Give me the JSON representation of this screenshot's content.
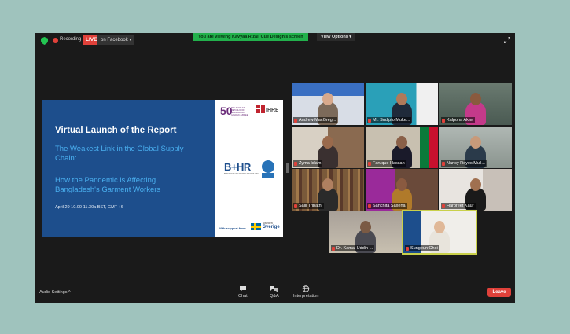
{
  "topbar": {
    "recording_label": "Recording",
    "live_badge": "LIVE",
    "live_destination": "on Facebook",
    "viewing_banner": "You are viewing Kavyaa Rizal, Cue Design's screen",
    "view_options": "View Options"
  },
  "slide": {
    "title": "Virtual Launch of the Report",
    "subtitle_1": "The Weakest Link in the Global Supply Chain:",
    "subtitle_2": "How the Pandemic is Affecting Bangladesh's Garment Workers",
    "date": "April 29 10.00-11.30a BST, GMT +6",
    "logo_50": "50",
    "logo_50_text": "THE PEOPLE'S REPUBLIC OF BANGLADESH GOLDEN JUBILEE",
    "logo_ihrb": "IHRB",
    "logo_bhr": "B+HR",
    "logo_bhr_sub": "BUSINESS AND HUMAN RIGHTS ASIA",
    "support_label": "With support from",
    "sweden_small": "Sweden",
    "sweden_large": "Sverige"
  },
  "participants": [
    {
      "name": "Andrew MacGreg..."
    },
    {
      "name": "Mr. Sudipto Muke..."
    },
    {
      "name": "Kalpona Akter"
    },
    {
      "name": "Zyma Islam"
    },
    {
      "name": "Faruque Hassan"
    },
    {
      "name": "Nancy Reyes Mull..."
    },
    {
      "name": "Salil Tripathi"
    },
    {
      "name": "Sanchita Saxena"
    },
    {
      "name": "Harpreet Kaur"
    },
    {
      "name": "Dr. Kamal Uddin ..."
    },
    {
      "name": "Sungeun Choi"
    }
  ],
  "bottombar": {
    "audio_settings": "Audio Settings",
    "chat": "Chat",
    "qa": "Q&A",
    "interpretation": "Interpretation",
    "leave": "Leave"
  },
  "colors": {
    "live": "#e0413a",
    "banner": "#22b14c",
    "slide_blue": "#1d4e8c",
    "slide_accent": "#4ab0f0",
    "active_speaker": "#c9d04a"
  }
}
